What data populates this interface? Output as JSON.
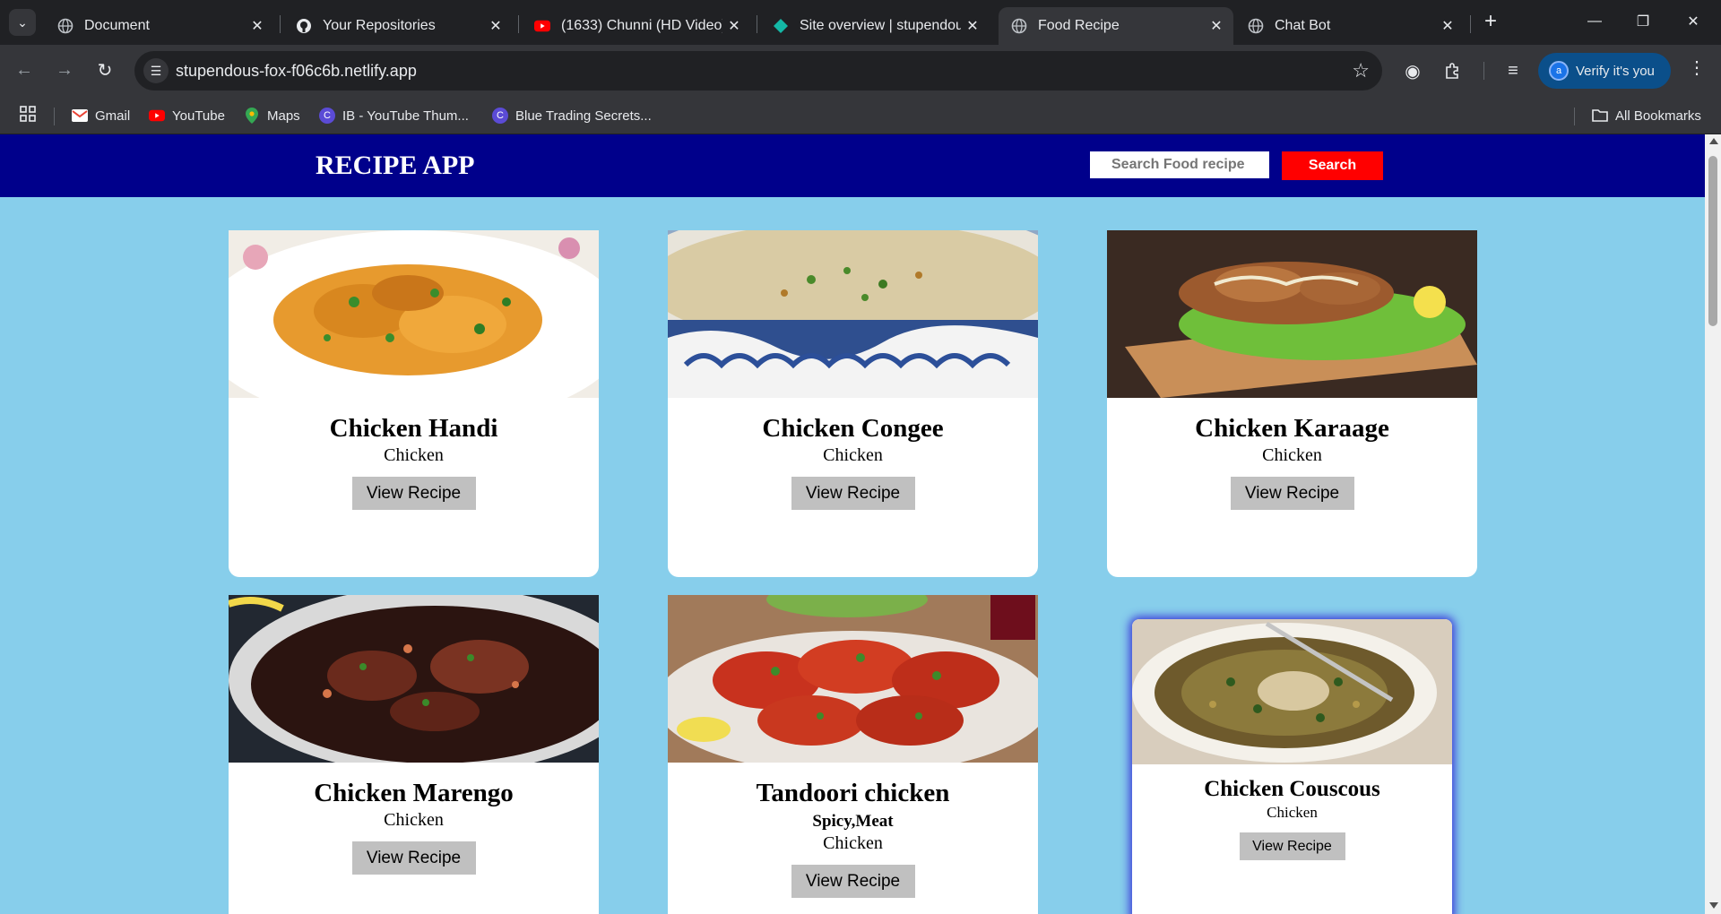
{
  "browser": {
    "tabs": [
      {
        "title": "Document",
        "icon": "globe-icon",
        "active": false
      },
      {
        "title": "Your Repositories",
        "icon": "github-icon",
        "active": false
      },
      {
        "title": "(1633) Chunni (HD Video) |",
        "icon": "youtube-icon",
        "active": false
      },
      {
        "title": "Site overview | stupendous",
        "icon": "netlify-icon",
        "active": false
      },
      {
        "title": "Food Recipe",
        "icon": "globe-icon",
        "active": true
      },
      {
        "title": "Chat Bot",
        "icon": "globe-icon",
        "active": false
      }
    ],
    "address_bar": {
      "url": "stupendous-fox-f06c6b.netlify.app"
    },
    "profile_button": {
      "label": "Verify it's you",
      "avatar_letter": "a"
    },
    "bookmarks": [
      {
        "label": "Gmail",
        "icon": "gmail-icon"
      },
      {
        "label": "YouTube",
        "icon": "youtube-icon"
      },
      {
        "label": "Maps",
        "icon": "maps-icon"
      },
      {
        "label": "IB - YouTube Thum...",
        "icon": "canva-icon"
      },
      {
        "label": "Blue Trading Secrets...",
        "icon": "canva-icon"
      }
    ],
    "all_bookmarks_label": "All Bookmarks",
    "colors": {
      "chrome_dark": "#202124",
      "toolbar": "#35363a",
      "accent": "#0b4f8a"
    }
  },
  "page": {
    "app_title": "RECIPE APP",
    "search": {
      "placeholder": "Search Food recipe",
      "value": "",
      "button_label": "Search"
    },
    "colors": {
      "background": "#87ceeb",
      "header": "#00008b",
      "search_button": "#ff0000",
      "view_button": "#c0c0c0"
    },
    "recipes": [
      {
        "name": "Chicken Handi",
        "tags": "",
        "category": "Chicken",
        "button": "View Recipe",
        "hovered": false
      },
      {
        "name": "Chicken Congee",
        "tags": "",
        "category": "Chicken",
        "button": "View Recipe",
        "hovered": false
      },
      {
        "name": "Chicken Karaage",
        "tags": "",
        "category": "Chicken",
        "button": "View Recipe",
        "hovered": false
      },
      {
        "name": "Chicken Marengo",
        "tags": "",
        "category": "Chicken",
        "button": "View Recipe",
        "hovered": false
      },
      {
        "name": "Tandoori chicken",
        "tags": "Spicy,Meat",
        "category": "Chicken",
        "button": "View Recipe",
        "hovered": false
      },
      {
        "name": "Chicken Couscous",
        "tags": "",
        "category": "Chicken",
        "button": "View Recipe",
        "hovered": true
      }
    ]
  }
}
